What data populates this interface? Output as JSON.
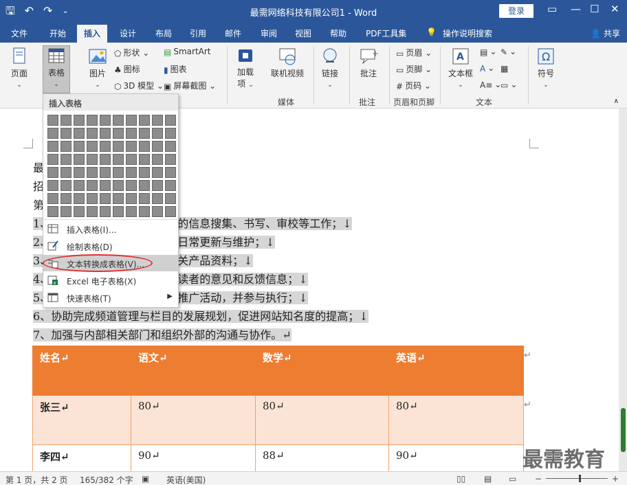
{
  "title": {
    "window_title": "最需网络科技有限公司1 - Word",
    "login": "登录",
    "min": "—",
    "restore": "☐",
    "close": "✕"
  },
  "tabs": [
    "文件",
    "开始",
    "插入",
    "设计",
    "布局",
    "引用",
    "邮件",
    "审阅",
    "视图",
    "帮助",
    "PDF工具集"
  ],
  "active_tab": "插入",
  "tell_me": "操作说明搜索",
  "share": "共享",
  "ribbon": {
    "page": "页面",
    "table": "表格",
    "pictures": "图片",
    "shapes": "形状",
    "icons": "图标",
    "model3d": "3D 模型",
    "smartart": "SmartArt",
    "chart": "图表",
    "screenshot": "屏幕截图",
    "addins": "加载\n项",
    "online_video": "联机视频",
    "link": "链接",
    "comment": "批注",
    "header": "页眉",
    "footer": "页脚",
    "pagenum": "页码",
    "textbox": "文本框",
    "symbol": "符号",
    "groups": {
      "media": "媒体",
      "comments": "批注",
      "header_footer": "页眉和页脚",
      "text": "文本"
    }
  },
  "dropdown": {
    "title": "插入表格",
    "items": [
      {
        "label": "插入表格(I)...",
        "icon": "table-icon"
      },
      {
        "label": "绘制表格(D)",
        "icon": "draw-table-icon"
      },
      {
        "label": "文本转换成表格(V)...",
        "icon": "convert-text-icon"
      },
      {
        "label": "Excel 电子表格(X)",
        "icon": "excel-icon"
      },
      {
        "label": "快速表格(T)",
        "icon": "quick-table-icon"
      }
    ]
  },
  "document": {
    "lines_top": [
      "最",
      "招",
      "第"
    ],
    "list": [
      {
        "prefix": "1、",
        "text": "的信息搜集、书写、审校等工作；↓"
      },
      {
        "prefix": "2、",
        "text": "日常更新与维护；↓"
      },
      {
        "prefix": "3、",
        "text": "关产品资料；↓"
      },
      {
        "prefix": "4、",
        "text": "读者的意见和反馈信息；↓"
      },
      {
        "prefix": "5、",
        "text": "推广活动，并参与执行；↓"
      },
      {
        "prefix": "6、",
        "text": "协助完成频道管理与栏目的发展规划，促进网站知名度的提高；↓"
      },
      {
        "prefix": "7、",
        "text": "加强与内部相关部门和组织外部的沟通与协作。↵"
      }
    ],
    "table": {
      "headers": [
        "姓名↵",
        "语文↵",
        "数学↵",
        "英语↵"
      ],
      "rows": [
        [
          "张三↵",
          "80↵",
          "80↵",
          "80↵"
        ],
        [
          "李四↵",
          "90↵",
          "88↵",
          "90↵"
        ]
      ],
      "row_end": "↵"
    }
  },
  "status": {
    "page": "第 1 页，共 2 页",
    "words": "165/382 个字",
    "lang": "英语(美国)"
  },
  "watermark": "最需教育"
}
